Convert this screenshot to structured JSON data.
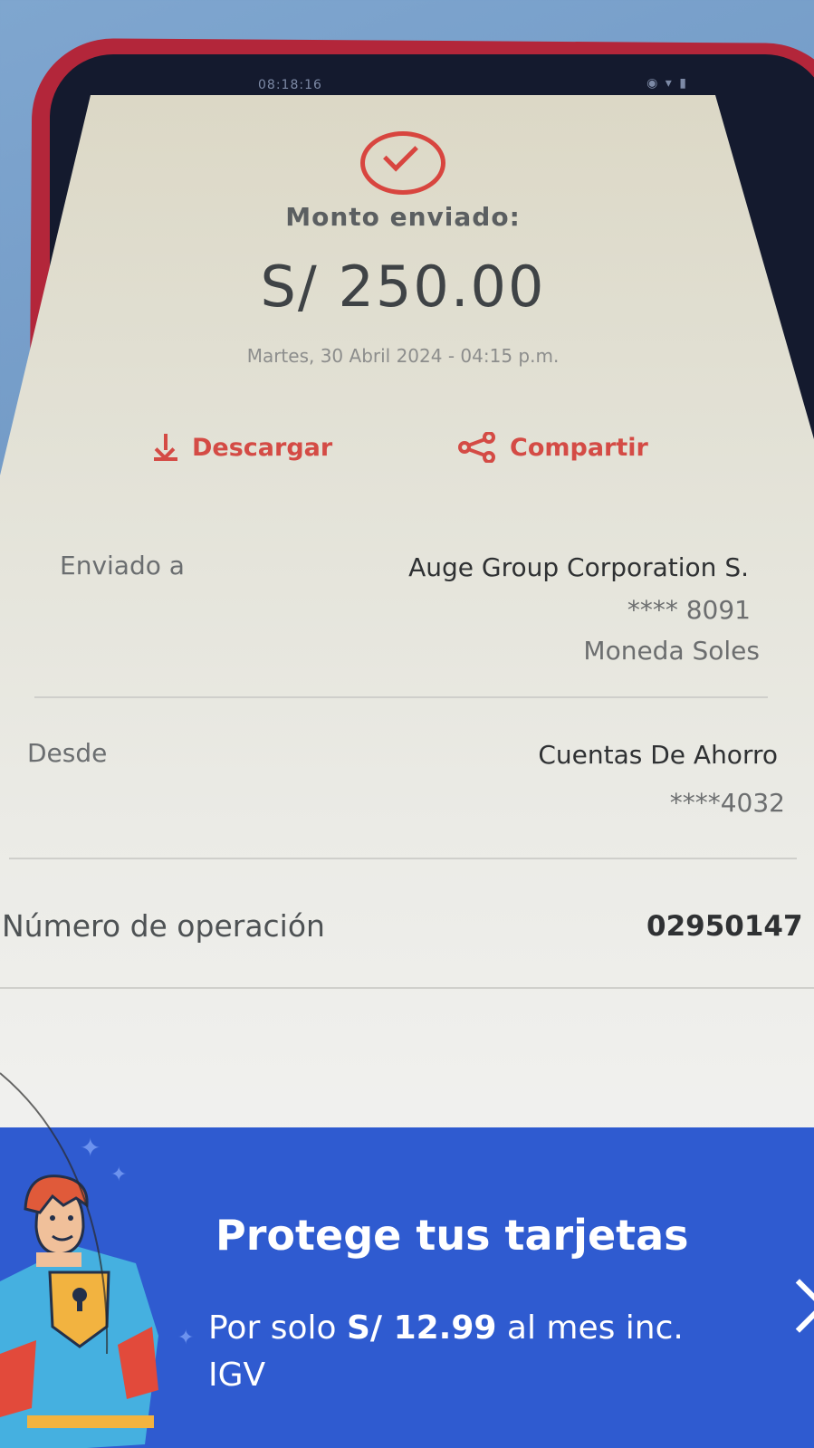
{
  "colors": {
    "accent": "#d44b45",
    "banner": "#2f5bd0",
    "phone_case": "#b3263a"
  },
  "status_bar": {
    "time": "08:18:16",
    "icons": "◉ ▾ ▮"
  },
  "receipt": {
    "success_icon": "check-circle-icon",
    "amount_label": "Monto enviado:",
    "amount": "S/ 250.00",
    "date": "Martes, 30 Abril 2024 - 04:15 p.m.",
    "actions": {
      "download_label": "Descargar",
      "download_icon": "download-icon",
      "share_label": "Compartir",
      "share_icon": "share-icon"
    },
    "sent_to": {
      "label": "Enviado a",
      "name": "Auge Group Corporation S.",
      "account": "**** 8091",
      "currency": "Moneda Soles"
    },
    "from": {
      "label": "Desde",
      "account_type": "Cuentas De Ahorro",
      "account": "****4032"
    },
    "operation": {
      "label": "Número de operación",
      "number": "02950147"
    }
  },
  "promo": {
    "title": "Protege tus tarjetas",
    "text_before": "Por solo ",
    "price": "S/ 12.99",
    "text_after": " al mes inc. IGV",
    "arrow_icon": "chevron-right-icon",
    "illustration": "superhero-illustration"
  }
}
